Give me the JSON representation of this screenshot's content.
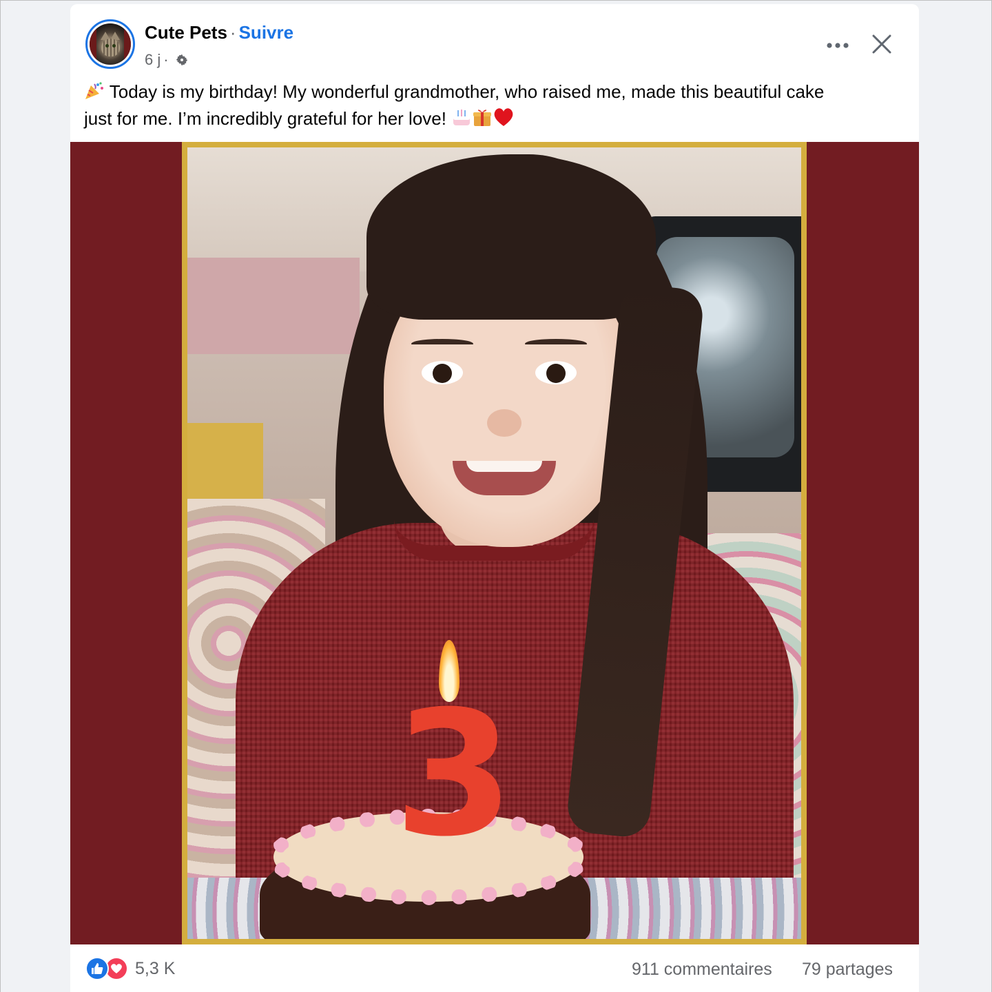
{
  "post": {
    "author": "Cute Pets",
    "separator": "·",
    "follow_label": "Suivre",
    "time": "6 j",
    "meta_separator": "·",
    "text_line_1": " Today is my birthday! My wonderful grandmother, who raised me, made this beautiful cake",
    "text_line_2": "just for me. I’m incredibly grateful for her love! ",
    "icons": {
      "audience": "gear-icon",
      "more": "more-options-icon",
      "close": "close-icon",
      "party": "party-popper-icon",
      "cake": "birthday-cake-icon",
      "gift": "gift-icon",
      "heart": "red-heart-icon"
    }
  },
  "media": {
    "candle_number": "3",
    "colors": {
      "background": "#721c22",
      "frame": "#d4ae3e"
    }
  },
  "footer": {
    "reaction_count": "5,3 K",
    "comments": "911 commentaires",
    "shares": "79 partages",
    "reaction_icons": [
      "like-icon",
      "love-icon"
    ]
  },
  "colors": {
    "accent": "#1b74e4",
    "love": "#f33e58",
    "muted_text": "#65676b"
  }
}
